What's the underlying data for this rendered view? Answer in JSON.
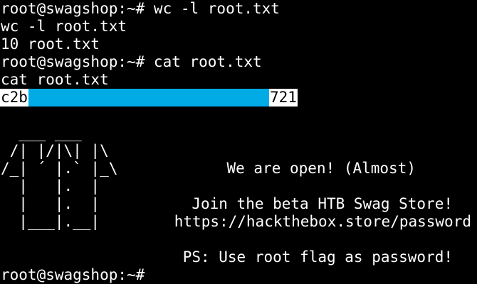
{
  "terminal": {
    "bg_color": "#000000",
    "fg_color": "#ffffff",
    "redaction_color": "#00abe6",
    "lines": [
      "root@swagshop:~# wc -l root.txt",
      "wc -l root.txt",
      "10 root.txt",
      "root@swagshop:~# cat root.txt",
      "cat root.txt"
    ],
    "flag": {
      "prefix": "c2b",
      "suffix": "721"
    },
    "ascii_art": "  ___ ___\n /| |/|\\| |\\\n/_| ´ |.` |_\\\n  |   |.  |\n  |   |.  |\n  |___|.__|",
    "messages": {
      "open": "We are open! (Almost)",
      "join": "Join the beta HTB Swag Store!",
      "url": "https://hackthebox.store/password",
      "ps": "PS: Use root flag as password!"
    },
    "prompt": "root@swagshop:~#"
  }
}
